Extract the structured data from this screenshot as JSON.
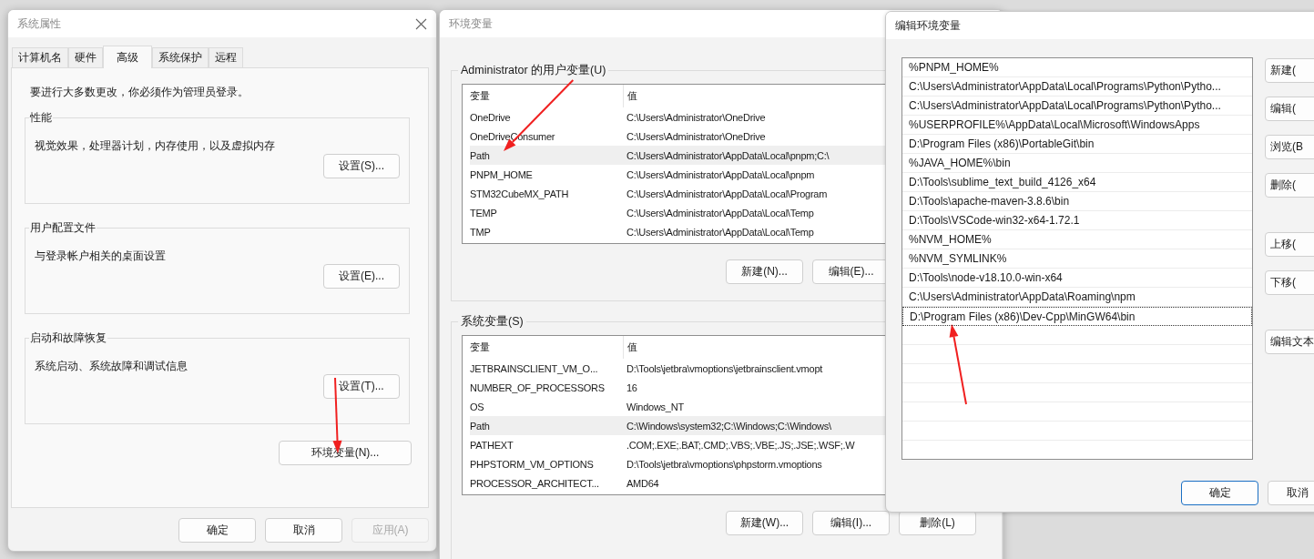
{
  "system_properties": {
    "title": "系统属性",
    "tabs": [
      {
        "label": "计算机名",
        "selected": false
      },
      {
        "label": "硬件",
        "selected": false
      },
      {
        "label": "高级",
        "selected": true
      },
      {
        "label": "系统保护",
        "selected": false
      },
      {
        "label": "远程",
        "selected": false
      }
    ],
    "notice": "要进行大多数更改，你必须作为管理员登录。",
    "groups": [
      {
        "title": "性能",
        "description": "视觉效果，处理器计划，内存使用，以及虚拟内存",
        "button": "设置(S)..."
      },
      {
        "title": "用户配置文件",
        "description": "与登录帐户相关的桌面设置",
        "button": "设置(E)..."
      },
      {
        "title": "启动和故障恢复",
        "description": "系统启动、系统故障和调试信息",
        "button": "设置(T)..."
      }
    ],
    "env_button": "环境变量(N)...",
    "buttons": [
      {
        "label": "确定",
        "disabled": false
      },
      {
        "label": "取消",
        "disabled": false
      },
      {
        "label": "应用(A)",
        "disabled": true
      }
    ]
  },
  "environment_variables": {
    "title": "环境变量",
    "sections": [
      {
        "title": "Administrator 的用户变量(U)",
        "columns": [
          "变量",
          "值"
        ],
        "rows": [
          {
            "name": "OneDrive",
            "value": "C:\\Users\\Administrator\\OneDrive",
            "selected": false
          },
          {
            "name": "OneDriveConsumer",
            "value": "C:\\Users\\Administrator\\OneDrive",
            "selected": false
          },
          {
            "name": "Path",
            "value": "C:\\Users\\Administrator\\AppData\\Local\\pnpm;C:\\",
            "selected": true
          },
          {
            "name": "PNPM_HOME",
            "value": "C:\\Users\\Administrator\\AppData\\Local\\pnpm",
            "selected": false
          },
          {
            "name": "STM32CubeMX_PATH",
            "value": "C:\\Users\\Administrator\\AppData\\Local\\Program",
            "selected": false
          },
          {
            "name": "TEMP",
            "value": "C:\\Users\\Administrator\\AppData\\Local\\Temp",
            "selected": false
          },
          {
            "name": "TMP",
            "value": "C:\\Users\\Administrator\\AppData\\Local\\Temp",
            "selected": false
          }
        ],
        "buttons": [
          "新建(N)...",
          "编辑(E)..."
        ]
      },
      {
        "title": "系统变量(S)",
        "columns": [
          "变量",
          "值"
        ],
        "rows": [
          {
            "name": "JETBRAINSCLIENT_VM_O...",
            "value": "D:\\Tools\\jetbra\\vmoptions\\jetbrainsclient.vmopt",
            "selected": false
          },
          {
            "name": "NUMBER_OF_PROCESSORS",
            "value": "16",
            "selected": false
          },
          {
            "name": "OS",
            "value": "Windows_NT",
            "selected": false
          },
          {
            "name": "Path",
            "value": "C:\\Windows\\system32;C:\\Windows;C:\\Windows\\",
            "selected": true
          },
          {
            "name": "PATHEXT",
            "value": ".COM;.EXE;.BAT;.CMD;.VBS;.VBE;.JS;.JSE;.WSF;.W",
            "selected": false
          },
          {
            "name": "PHPSTORM_VM_OPTIONS",
            "value": "D:\\Tools\\jetbra\\vmoptions\\phpstorm.vmoptions",
            "selected": false
          },
          {
            "name": "PROCESSOR_ARCHITECT...",
            "value": "AMD64",
            "selected": false
          }
        ],
        "buttons": [
          "新建(W)...",
          "编辑(I)...",
          "删除(L)"
        ]
      }
    ]
  },
  "edit_environment_variable": {
    "title": "编辑环境变量",
    "entries": [
      {
        "text": "%PNPM_HOME%",
        "selected": false
      },
      {
        "text": "C:\\Users\\Administrator\\AppData\\Local\\Programs\\Python\\Pytho...",
        "selected": false
      },
      {
        "text": "C:\\Users\\Administrator\\AppData\\Local\\Programs\\Python\\Pytho...",
        "selected": false
      },
      {
        "text": "%USERPROFILE%\\AppData\\Local\\Microsoft\\WindowsApps",
        "selected": false
      },
      {
        "text": "D:\\Program Files (x86)\\PortableGit\\bin",
        "selected": false
      },
      {
        "text": "%JAVA_HOME%\\bin",
        "selected": false
      },
      {
        "text": "D:\\Tools\\sublime_text_build_4126_x64",
        "selected": false
      },
      {
        "text": "D:\\Tools\\apache-maven-3.8.6\\bin",
        "selected": false
      },
      {
        "text": "D:\\Tools\\VSCode-win32-x64-1.72.1",
        "selected": false
      },
      {
        "text": "%NVM_HOME%",
        "selected": false
      },
      {
        "text": "%NVM_SYMLINK%",
        "selected": false
      },
      {
        "text": "D:\\Tools\\node-v18.10.0-win-x64",
        "selected": false
      },
      {
        "text": "C:\\Users\\Administrator\\AppData\\Roaming\\npm",
        "selected": false
      },
      {
        "text": "D:\\Program Files (x86)\\Dev-Cpp\\MinGW64\\bin",
        "selected": true
      }
    ],
    "side_buttons": [
      "新建(",
      "编辑(",
      "浏览(B",
      "删除(",
      "上移(",
      "下移(",
      "编辑文本"
    ],
    "buttons": [
      {
        "label": "确定",
        "default": true
      },
      {
        "label": "取消",
        "default": false
      }
    ]
  }
}
